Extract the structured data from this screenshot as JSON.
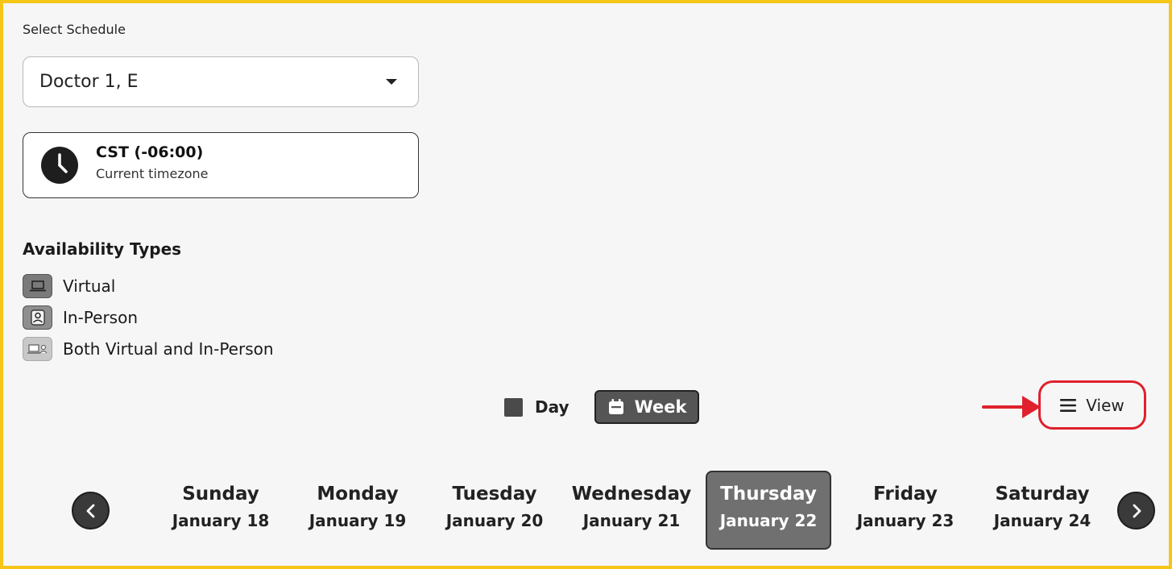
{
  "select_schedule": {
    "label": "Select Schedule",
    "value": "Doctor 1, E",
    "icon": "caret-down-icon"
  },
  "timezone": {
    "title": "CST (-06:00)",
    "subtitle": "Current timezone",
    "icon": "clock-icon"
  },
  "availability": {
    "heading": "Availability Types",
    "types": [
      {
        "label": "Virtual",
        "icon": "laptop-icon",
        "color": "#7a7a7a"
      },
      {
        "label": "In-Person",
        "icon": "person-icon",
        "color": "#8e8e8e"
      },
      {
        "label": "Both Virtual and In-Person",
        "icon": "laptop-person-icon",
        "color": "#c8c8c8"
      }
    ]
  },
  "view_toggle": {
    "day_label": "Day",
    "week_label": "Week",
    "selected": "Week"
  },
  "view_menu": {
    "label": "View",
    "icon": "hamburger-icon",
    "highlight_color": "#e0212d"
  },
  "week": {
    "days": [
      {
        "name": "Sunday",
        "date": "January 18"
      },
      {
        "name": "Monday",
        "date": "January 19"
      },
      {
        "name": "Tuesday",
        "date": "January 20"
      },
      {
        "name": "Wednesday",
        "date": "January 21"
      },
      {
        "name": "Thursday",
        "date": "January 22"
      },
      {
        "name": "Friday",
        "date": "January 23"
      },
      {
        "name": "Saturday",
        "date": "January 24"
      }
    ],
    "selected_day": "Thursday"
  },
  "colors": {
    "frame_border": "#f5c518",
    "annotation": "#e0212d",
    "selected_day_bg": "#707070",
    "week_button_bg": "#555555"
  }
}
